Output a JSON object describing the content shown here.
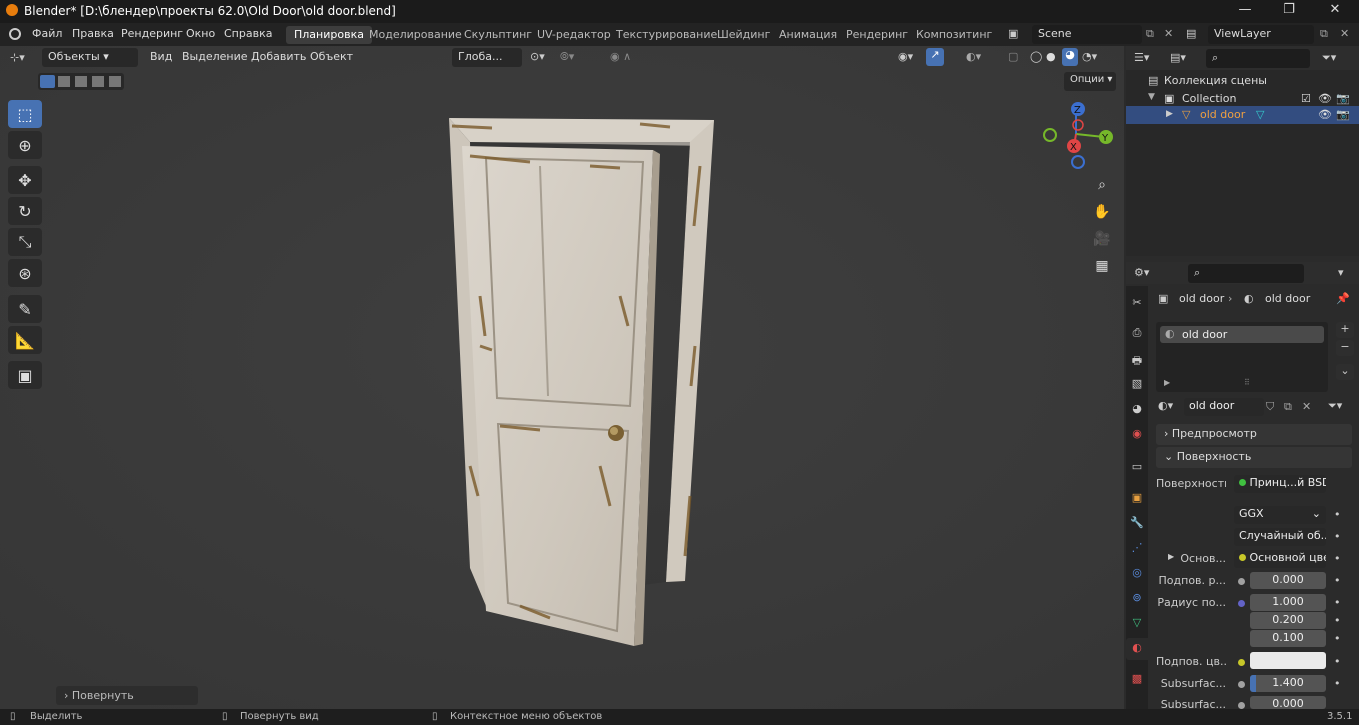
{
  "window": {
    "title": "Blender* [D:\\блендер\\проекты 62.0\\Old Door\\old door.blend]",
    "minimize": "—",
    "maximize": "❐",
    "close": "✕"
  },
  "menu": [
    "Файл",
    "Правка",
    "Рендеринг",
    "Окно",
    "Справка"
  ],
  "workspaces": [
    "Планировка",
    "Моделирование",
    "Скульптинг",
    "UV-редактор",
    "Текстурирование",
    "Шейдинг",
    "Анимация",
    "Рендеринг",
    "Композитинг"
  ],
  "active_workspace": "Планировка",
  "scene": "Scene",
  "view_layer": "ViewLayer",
  "viewport": {
    "mode": "Объекты",
    "menus": [
      "Вид",
      "Выделение",
      "Добавить",
      "Объект"
    ],
    "orientation": "Глоба...",
    "options": "Опции",
    "last_op": "Повернуть",
    "gizmo": {
      "z": "Z",
      "y": "Y",
      "x": "X"
    }
  },
  "outliner": {
    "root": "Коллекция сцены",
    "collection": "Collection",
    "object": "old door"
  },
  "properties": {
    "breadcrumb_object": "old door",
    "breadcrumb_material": "old door",
    "material_slot": "old door",
    "material_name": "old door",
    "panel_preview": "Предпросмотр",
    "panel_surface": "Поверхность",
    "surface_label": "Поверхность",
    "surface_value": "Принц...й BSDF",
    "distribution": "GGX",
    "subsurface_method": "Случайный об...",
    "base_label": "Основ...",
    "base_value": "Основной цвет",
    "subsurface_label": "Подпов. р...",
    "subsurface_value": "0.000",
    "radius_label": "Радиус по...",
    "radius_values": [
      "1.000",
      "0.200",
      "0.100"
    ],
    "subsurface_color_label": "Подпов. цв...",
    "subsurface_ior_label": "Subsurfac...",
    "subsurface_ior_value": "1.400",
    "subsurface_aniso_label": "Subsurfac...",
    "subsurface_aniso_value": "0.000"
  },
  "status": {
    "select": "Выделить",
    "rotate_view": "Повернуть вид",
    "context_menu": "Контекстное меню объектов",
    "version": "3.5.1"
  },
  "colors": {
    "accent": "#4772b3",
    "door": "#d9d2c7",
    "rust": "#7a5a2a"
  }
}
